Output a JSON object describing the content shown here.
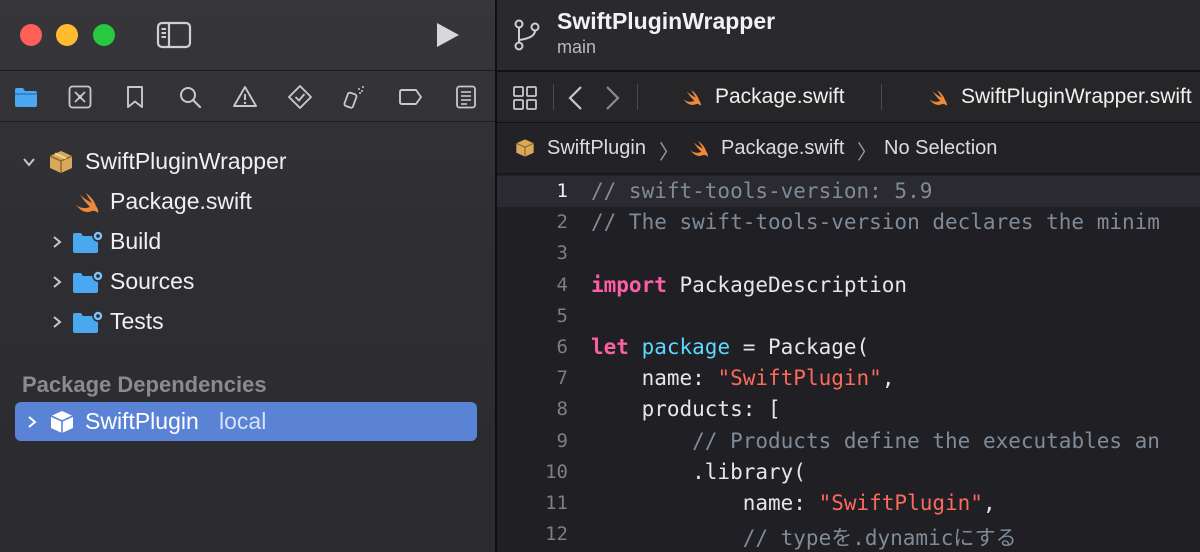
{
  "window": {
    "project_title": "SwiftPluginWrapper",
    "branch": "main"
  },
  "navigator": {
    "tabs": [
      {
        "name": "project-navigator",
        "icon": "folder-icon",
        "active": true
      },
      {
        "name": "source-control-navigator",
        "icon": "source-control-icon"
      },
      {
        "name": "bookmark-navigator",
        "icon": "bookmark-icon"
      },
      {
        "name": "find-navigator",
        "icon": "search-icon"
      },
      {
        "name": "issue-navigator",
        "icon": "warning-icon"
      },
      {
        "name": "test-navigator",
        "icon": "test-diamond-icon"
      },
      {
        "name": "debug-navigator",
        "icon": "spray-icon"
      },
      {
        "name": "breakpoint-navigator",
        "icon": "breakpoint-icon"
      },
      {
        "name": "report-navigator",
        "icon": "report-icon"
      }
    ],
    "tree": [
      {
        "label": "SwiftPluginWrapper",
        "icon": "package-icon",
        "expanded": true
      },
      {
        "label": "Package.swift",
        "icon": "swift-icon"
      },
      {
        "label": "Build",
        "icon": "folder-gear-icon",
        "expanded": false
      },
      {
        "label": "Sources",
        "icon": "folder-gear-icon",
        "expanded": false
      },
      {
        "label": "Tests",
        "icon": "folder-gear-icon",
        "expanded": false
      }
    ],
    "dependencies_header": "Package Dependencies",
    "dependencies": [
      {
        "label": "SwiftPlugin",
        "sublabel": "local",
        "icon": "package-icon",
        "selected": true
      }
    ]
  },
  "editor": {
    "tabs": [
      {
        "label": "Package.swift",
        "icon": "swift-icon"
      },
      {
        "label": "SwiftPluginWrapper.swift",
        "icon": "swift-icon"
      }
    ],
    "breadcrumb": [
      {
        "label": "SwiftPlugin",
        "icon": "package-icon"
      },
      {
        "label": "Package.swift",
        "icon": "swift-icon"
      },
      {
        "label": "No Selection"
      }
    ],
    "breadcrumb_separator": "〉",
    "current_line": 1,
    "lines": [
      {
        "n": "1",
        "tokens": [
          {
            "t": "comment",
            "v": "// swift-tools-version: 5.9"
          }
        ]
      },
      {
        "n": "2",
        "tokens": [
          {
            "t": "comment",
            "v": "// The swift-tools-version declares the minim"
          }
        ]
      },
      {
        "n": "3",
        "tokens": []
      },
      {
        "n": "4",
        "tokens": [
          {
            "t": "kw",
            "v": "import"
          },
          {
            "t": "plain",
            "v": " PackageDescription"
          }
        ]
      },
      {
        "n": "5",
        "tokens": []
      },
      {
        "n": "6",
        "tokens": [
          {
            "t": "kw",
            "v": "let"
          },
          {
            "t": "plain",
            "v": " "
          },
          {
            "t": "decl",
            "v": "package"
          },
          {
            "t": "plain",
            "v": " = Package("
          }
        ]
      },
      {
        "n": "7",
        "tokens": [
          {
            "t": "plain",
            "v": "    name: "
          },
          {
            "t": "str",
            "v": "\"SwiftPlugin\""
          },
          {
            "t": "plain",
            "v": ","
          }
        ]
      },
      {
        "n": "8",
        "tokens": [
          {
            "t": "plain",
            "v": "    products: ["
          }
        ]
      },
      {
        "n": "9",
        "tokens": [
          {
            "t": "plain",
            "v": "        "
          },
          {
            "t": "comment",
            "v": "// Products define the executables an"
          }
        ]
      },
      {
        "n": "10",
        "tokens": [
          {
            "t": "plain",
            "v": "        .library("
          }
        ]
      },
      {
        "n": "11",
        "tokens": [
          {
            "t": "plain",
            "v": "            name: "
          },
          {
            "t": "str",
            "v": "\"SwiftPlugin\""
          },
          {
            "t": "plain",
            "v": ","
          }
        ]
      },
      {
        "n": "12",
        "tokens": [
          {
            "t": "plain",
            "v": "            "
          },
          {
            "t": "comment",
            "v": "// typeを.dynamicにする"
          }
        ]
      }
    ]
  },
  "colors": {
    "keyword": "#fc5fa3",
    "string": "#fc6a5d",
    "comment": "#7f8c98",
    "declaration": "#5dd8ff",
    "selection": "#5a83d6",
    "folder_blue": "#4aa8f0",
    "swift_orange": "#f0883a"
  }
}
